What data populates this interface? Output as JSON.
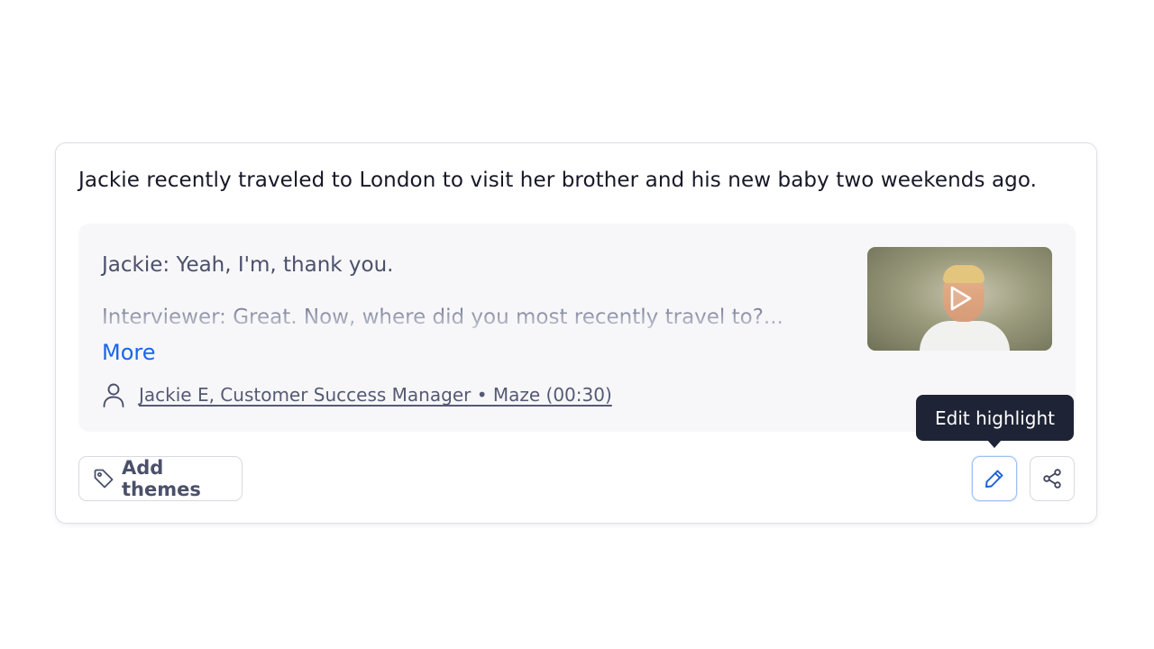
{
  "highlight": {
    "title": "Jackie recently traveled to London to visit her brother and his new baby two weekends ago.",
    "transcript": {
      "line1": "Jackie: Yeah, I'm, thank you.",
      "line2": "Interviewer: Great. Now, where did you most recently travel to?...",
      "more_label": "More"
    },
    "attribution": {
      "icon": "person-icon",
      "text": "Jackie E, Customer Success Manager • Maze (00:30)"
    },
    "video": {
      "icon": "play-icon"
    }
  },
  "actions": {
    "add_themes_label": "Add themes",
    "add_themes_icon": "tag-icon",
    "edit_icon": "pencil-icon",
    "share_icon": "share-icon",
    "tooltip": "Edit highlight"
  },
  "colors": {
    "link": "#1a66e6",
    "tooltip_bg": "#1e2436",
    "quote_bg": "#f7f7f9"
  }
}
